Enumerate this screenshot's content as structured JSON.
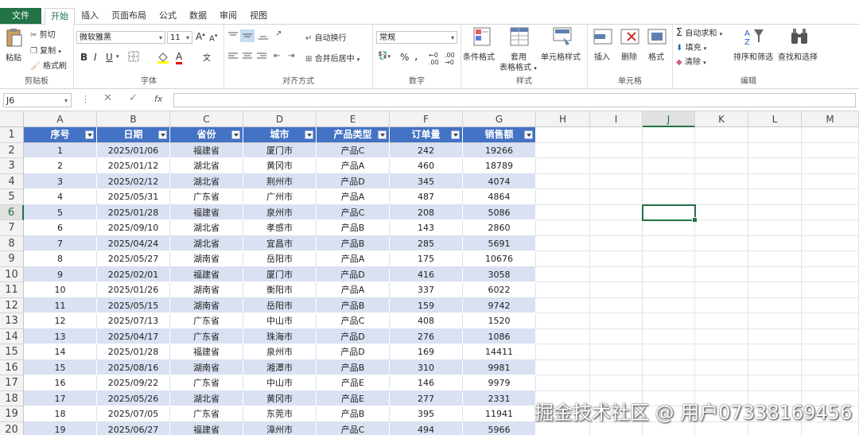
{
  "tabs": {
    "file": "文件",
    "items": [
      "开始",
      "插入",
      "页面布局",
      "公式",
      "数据",
      "审阅",
      "视图"
    ]
  },
  "ribbon": {
    "clipboard": {
      "paste": "粘贴",
      "cut": "剪切",
      "copy": "复制",
      "format_painter": "格式刷",
      "label": "剪贴板"
    },
    "font": {
      "name": "微软雅黑",
      "size": "11",
      "label": "字体",
      "bold": "B",
      "italic": "I",
      "underline": "U",
      "grow": "A",
      "shrink": "A",
      "color": "A",
      "wen": "文"
    },
    "alignment": {
      "wrap": "自动换行",
      "merge": "合并后居中",
      "label": "对齐方式"
    },
    "number": {
      "format": "常规",
      "percent": "%",
      "comma": ",",
      "label": "数字"
    },
    "styles": {
      "conditional": "条件格式",
      "table_line1": "套用",
      "table_line2": "表格格式",
      "cell_styles": "单元格样式",
      "label": "样式"
    },
    "cells": {
      "insert": "插入",
      "delete": "删除",
      "format": "格式",
      "label": "单元格"
    },
    "editing": {
      "autosum": "自动求和",
      "fill": "填充",
      "clear": "清除",
      "sort": "排序和筛选",
      "find": "查找和选择",
      "label": "编辑"
    }
  },
  "formula_bar": {
    "name_box": "J6",
    "fx": "fx"
  },
  "columns": [
    "A",
    "B",
    "C",
    "D",
    "E",
    "F",
    "G",
    "H",
    "I",
    "J",
    "K",
    "L",
    "M"
  ],
  "selected_column": "J",
  "selected_row": "6",
  "table": {
    "headers": [
      "序号",
      "日期",
      "省份",
      "城市",
      "产品类型",
      "订单量",
      "销售额"
    ],
    "rows": [
      [
        "1",
        "2025/01/06",
        "福建省",
        "厦门市",
        "产品C",
        "242",
        "19266"
      ],
      [
        "2",
        "2025/01/12",
        "湖北省",
        "黄冈市",
        "产品A",
        "460",
        "18789"
      ],
      [
        "3",
        "2025/02/12",
        "湖北省",
        "荆州市",
        "产品D",
        "345",
        "4074"
      ],
      [
        "4",
        "2025/05/31",
        "广东省",
        "广州市",
        "产品A",
        "487",
        "4864"
      ],
      [
        "5",
        "2025/01/28",
        "福建省",
        "泉州市",
        "产品C",
        "208",
        "5086"
      ],
      [
        "6",
        "2025/09/10",
        "湖北省",
        "孝感市",
        "产品B",
        "143",
        "2860"
      ],
      [
        "7",
        "2025/04/24",
        "湖北省",
        "宜昌市",
        "产品B",
        "285",
        "5691"
      ],
      [
        "8",
        "2025/05/27",
        "湖南省",
        "岳阳市",
        "产品A",
        "175",
        "10676"
      ],
      [
        "9",
        "2025/02/01",
        "福建省",
        "厦门市",
        "产品D",
        "416",
        "3058"
      ],
      [
        "10",
        "2025/01/26",
        "湖南省",
        "衡阳市",
        "产品A",
        "337",
        "6022"
      ],
      [
        "11",
        "2025/05/15",
        "湖南省",
        "岳阳市",
        "产品B",
        "159",
        "9742"
      ],
      [
        "12",
        "2025/07/13",
        "广东省",
        "中山市",
        "产品C",
        "408",
        "1520"
      ],
      [
        "13",
        "2025/04/17",
        "广东省",
        "珠海市",
        "产品D",
        "276",
        "1086"
      ],
      [
        "14",
        "2025/01/28",
        "福建省",
        "泉州市",
        "产品D",
        "169",
        "14411"
      ],
      [
        "15",
        "2025/08/16",
        "湖南省",
        "湘潭市",
        "产品B",
        "310",
        "9981"
      ],
      [
        "16",
        "2025/09/22",
        "广东省",
        "中山市",
        "产品E",
        "146",
        "9979"
      ],
      [
        "17",
        "2025/05/26",
        "湖北省",
        "黄冈市",
        "产品E",
        "277",
        "2331"
      ],
      [
        "18",
        "2025/07/05",
        "广东省",
        "东莞市",
        "产品B",
        "395",
        "11941"
      ],
      [
        "19",
        "2025/06/27",
        "福建省",
        "漳州市",
        "产品C",
        "494",
        "5966"
      ]
    ]
  },
  "watermark": "掘金技术社区 @ 用户07338169456",
  "colors": {
    "accent": "#217346",
    "table_header": "#4472c4",
    "band": "#d9e1f2"
  }
}
